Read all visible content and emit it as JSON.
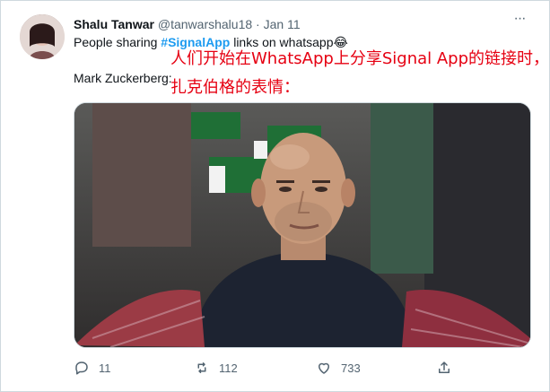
{
  "tweet": {
    "author_name": "Shalu Tanwar",
    "handle": "@tanwarshalu18",
    "dot": "·",
    "date": "Jan 11",
    "text_prefix": "People sharing ",
    "hashtag": "#SignalApp",
    "text_suffix": " links on whatsapp😂",
    "text_line2": "Mark Zuckerberg:",
    "overlay_line1": "人们开始在WhatsApp上分享Signal App的链接时，",
    "overlay_line2": "扎克伯格的表情：",
    "reply_count": "11",
    "retweet_count": "112",
    "like_count": "733"
  },
  "icons": {
    "more": "more-icon",
    "reply": "reply-icon",
    "retweet": "retweet-icon",
    "like": "like-icon",
    "share": "share-icon"
  },
  "colors": {
    "hashtag": "#1d9bf0",
    "overlay_text": "#e60012",
    "secondary_text": "#536471"
  }
}
